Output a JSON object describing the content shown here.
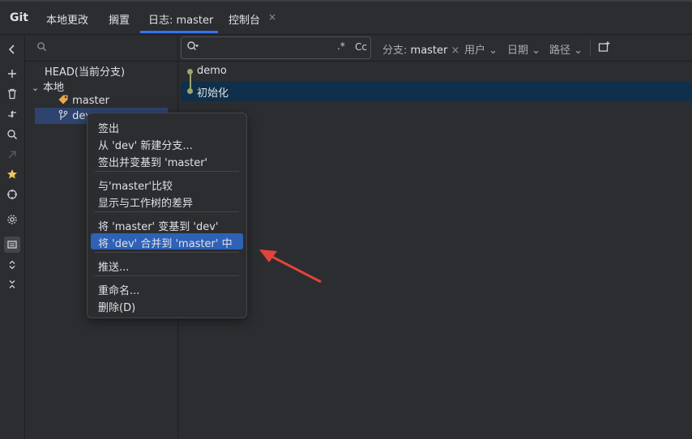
{
  "tabs": {
    "title": "Git",
    "items": [
      "本地更改",
      "搁置",
      "日志: master",
      "控制台"
    ],
    "close": "×"
  },
  "branches": {
    "search_icon": "magnifier-icon",
    "head": "HEAD(当前分支)",
    "local": "本地",
    "master": "master",
    "dev": "dev"
  },
  "log": {
    "search_placeholder": "",
    "regex": ".*",
    "case": "Cc",
    "filter_branch_label": "分支:",
    "filter_branch_value": "master",
    "filter_user": "用户",
    "filter_date": "日期",
    "filter_path": "路径",
    "commits": [
      "demo",
      "初始化"
    ]
  },
  "context_menu": {
    "checkout": "签出",
    "new_branch": "从 'dev' 新建分支...",
    "checkout_rebase": "签出并变基到 'master'",
    "compare": "与'master'比较",
    "show_diff": "显示与工作树的差异",
    "rebase": "将 'master' 变基到 'dev'",
    "merge": "将 'dev' 合并到 'master' 中",
    "push": "推送...",
    "rename": "重命名...",
    "delete": "删除(D)"
  },
  "colors": {
    "accent": "#3574f0",
    "selection": "#2e61b7",
    "arrow": "#e2433b"
  }
}
